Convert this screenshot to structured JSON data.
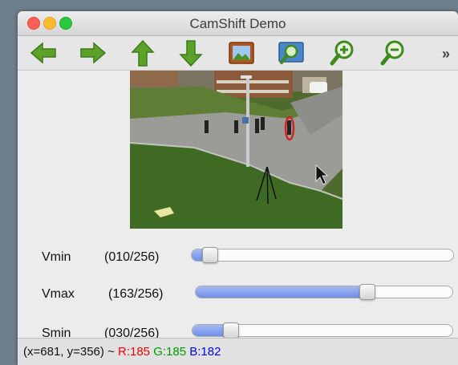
{
  "window": {
    "title": "CamShift Demo"
  },
  "toolbar": {
    "buttons": [
      {
        "icon": "arrow-left-icon"
      },
      {
        "icon": "arrow-right-icon"
      },
      {
        "icon": "arrow-up-icon"
      },
      {
        "icon": "arrow-down-icon"
      },
      {
        "icon": "image-icon"
      },
      {
        "icon": "zoom-fit-icon"
      },
      {
        "icon": "zoom-in-icon"
      },
      {
        "icon": "zoom-out-icon"
      }
    ],
    "overflow_label": "»"
  },
  "sliders": [
    {
      "label": "Vmin",
      "value_text": "(010/256)",
      "fraction": 0.039
    },
    {
      "label": "Vmax",
      "value_text": "(163/256)",
      "fraction": 0.637
    },
    {
      "label": "Smin",
      "value_text": "(030/256)",
      "fraction": 0.117
    }
  ],
  "status": {
    "coords": "(x=681, y=356) ~",
    "r": "R:185",
    "g": "G:185",
    "b": "B:182"
  },
  "colors": {
    "slider_fill": "#7b97ea",
    "r": "#ff0000",
    "g": "#009a00",
    "b": "#0000ff",
    "tracked_ellipse": "#d3241f"
  }
}
